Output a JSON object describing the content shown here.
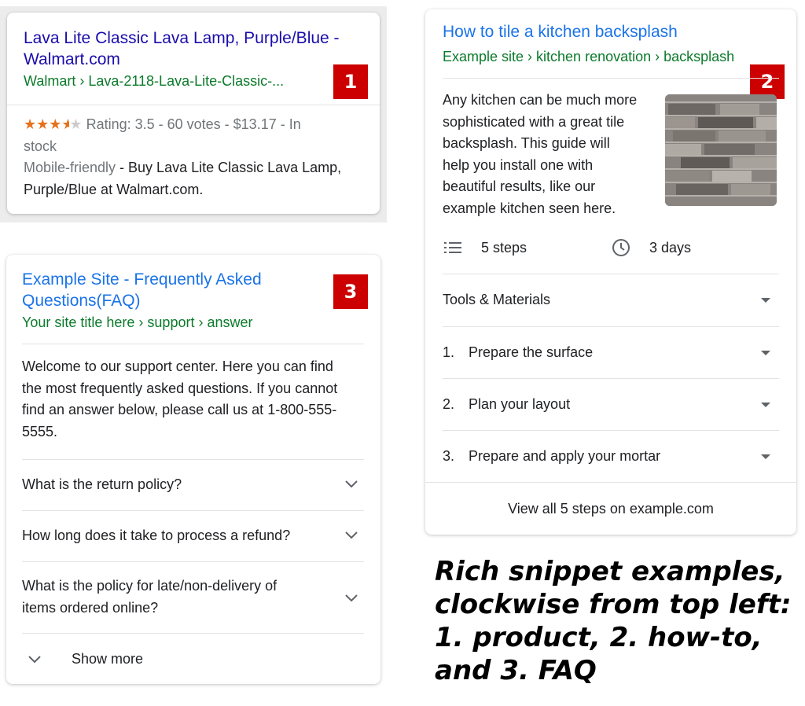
{
  "product_card": {
    "title_line1": "Lava Lite Classic Lava Lamp, Purple/Blue -",
    "title_line2": "Walmart.com",
    "breadcrumb": "Walmart › Lava-2118-Lava-Lite-Classic-...",
    "badge": "1",
    "stars": "★★★",
    "star_half": "★",
    "star_empty": "★",
    "rating_text_line1": " Rating: 3.5 - 60 votes - $13.17 - In",
    "rating_text_line2": "stock",
    "mobile_label": "Mobile-friendly",
    "desc_line1_rest": " - Buy Lava Lite Classic Lava Lamp,",
    "desc_line2": "Purple/Blue at Walmart.com."
  },
  "howto_card": {
    "title": "How to tile a kitchen backsplash",
    "breadcrumb": "Example site › kitchen renovation › backsplash",
    "badge": "2",
    "desc_lines": [
      "Any kitchen can be much more",
      "sophisticated with a great tile",
      "backsplash. This guide will",
      "help you install one with",
      "beautiful results, like our",
      "example kitchen seen here."
    ],
    "steps_count": "5 steps",
    "duration": "3 days",
    "tools_label": "Tools & Materials",
    "steps": [
      {
        "num": "1.",
        "label": "Prepare the surface"
      },
      {
        "num": "2.",
        "label": "Plan your layout"
      },
      {
        "num": "3.",
        "label": "Prepare and apply your mortar"
      }
    ],
    "view_all": "View all 5 steps on example.com"
  },
  "faq_card": {
    "title_line1": "Example Site - Frequently Asked",
    "title_line2": "Questions(FAQ)",
    "breadcrumb": "Your site title here › support › answer",
    "badge": "3",
    "desc_lines": [
      "Welcome to our support center. Here you can find",
      "the most frequently asked questions. If you cannot",
      "find an answer below, please call us at 1-800-555-",
      "5555."
    ],
    "questions": [
      {
        "line1": "What is the return policy?",
        "line2": ""
      },
      {
        "line1": "How long does it take to process a refund?",
        "line2": ""
      },
      {
        "line1": "What is the policy for late/non-delivery of",
        "line2": "items ordered online?"
      }
    ],
    "show_more": "Show more"
  },
  "caption": {
    "lines": [
      "Rich snippet examples,",
      "clockwise from top left:",
      "1. product, 2. how-to,",
      "and 3. FAQ"
    ]
  },
  "colors": {
    "link_title": "#1a0dab",
    "link_blue": "#1a73e8",
    "breadcrumb_green": "#0b7a2a",
    "badge_red": "#cc0000",
    "star_orange": "#e7711b"
  },
  "icons": [
    "list-icon",
    "clock-icon",
    "caret-down-icon",
    "chevron-down-icon"
  ]
}
